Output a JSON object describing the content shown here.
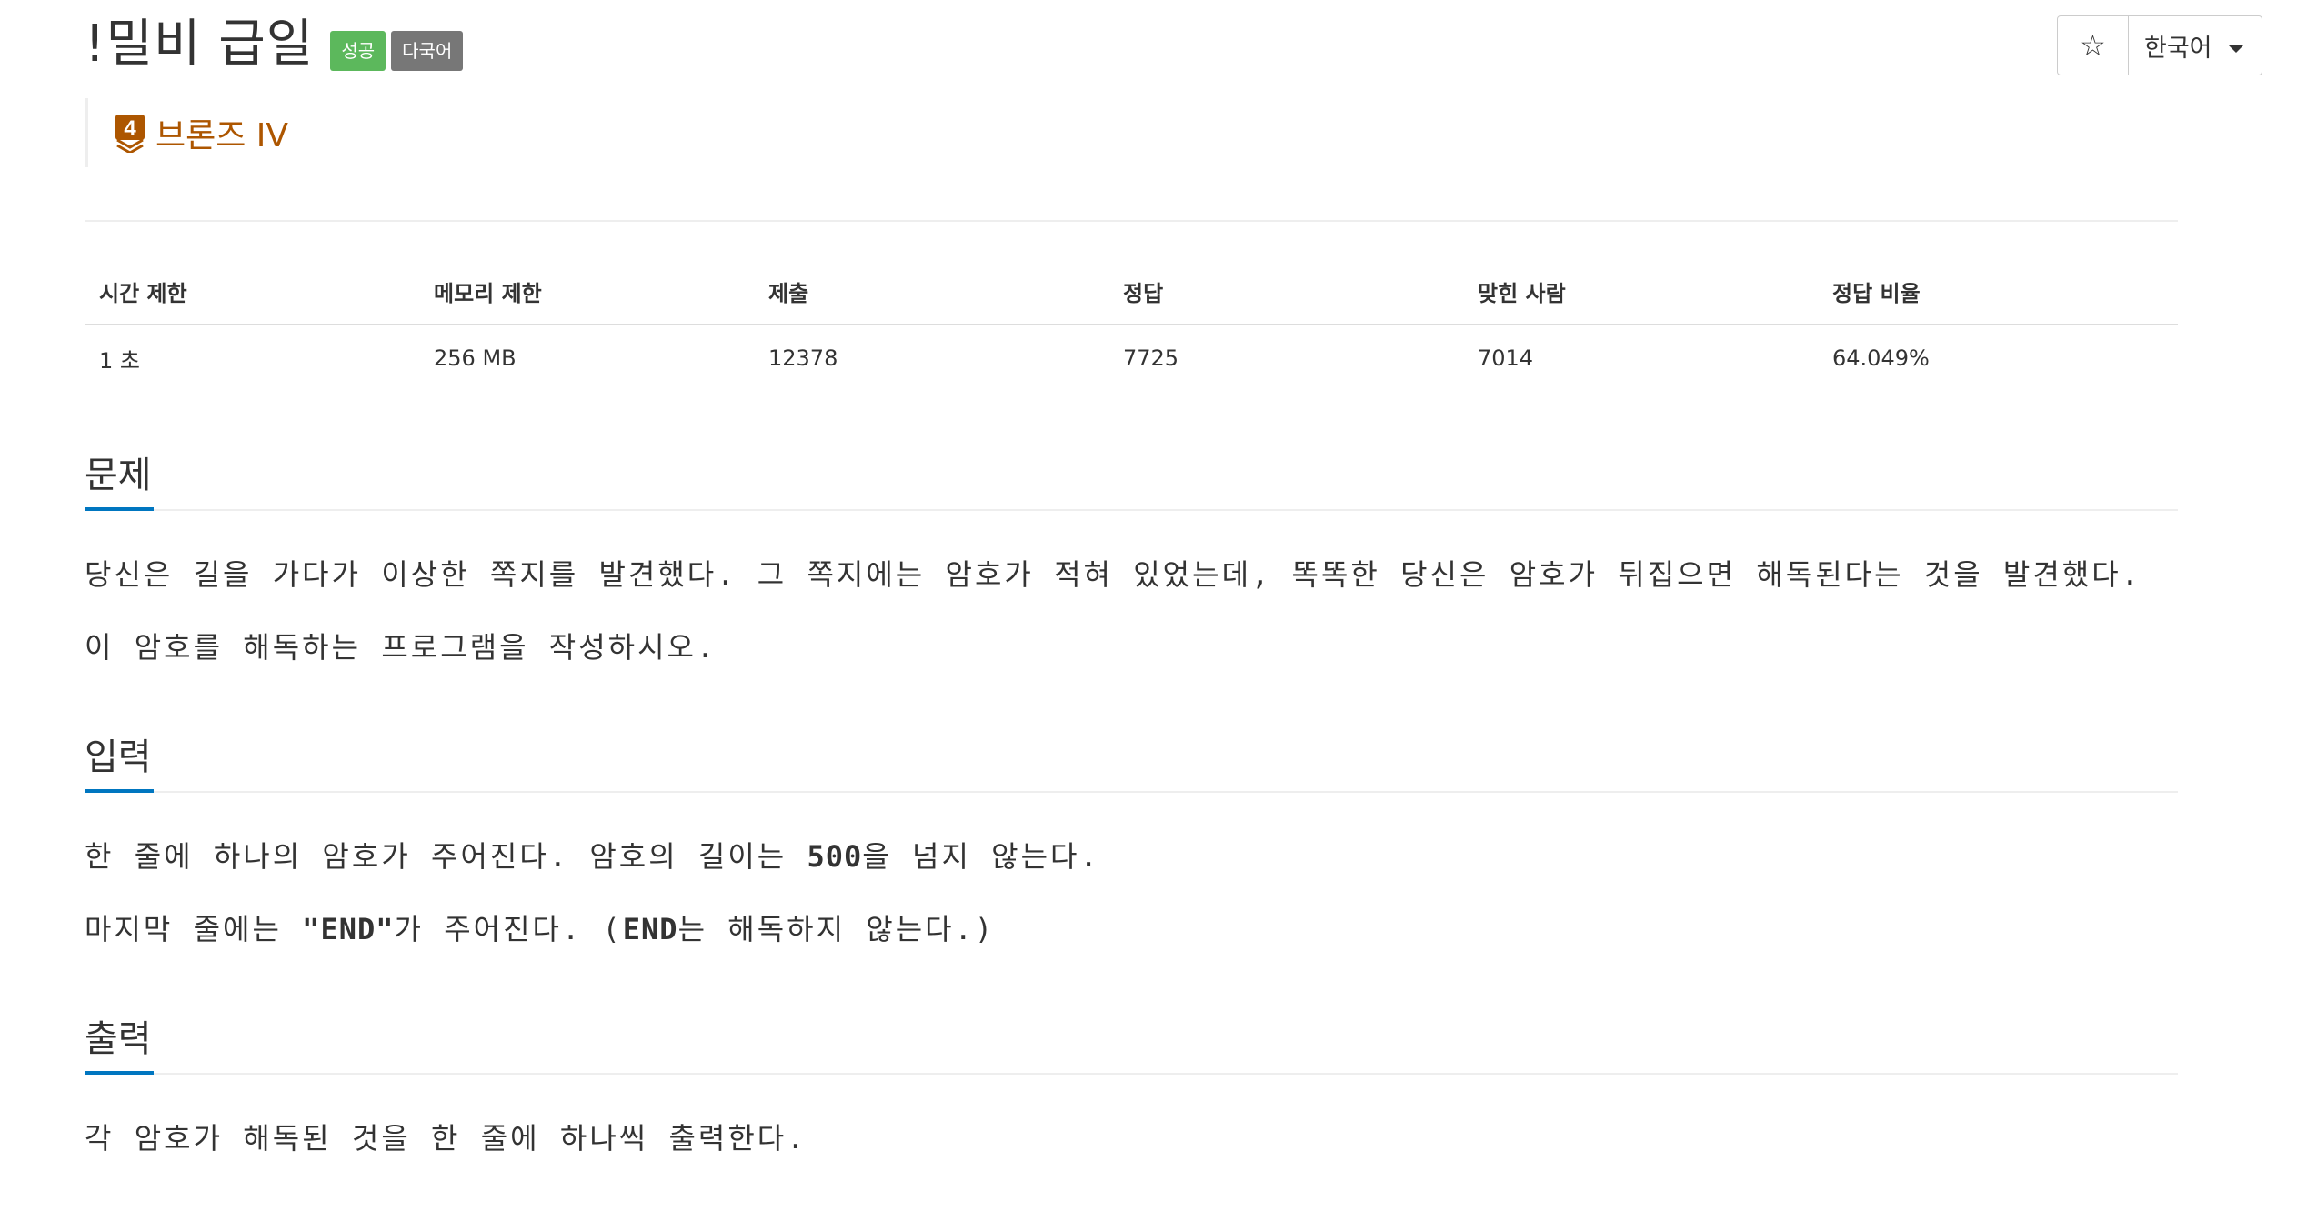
{
  "problem": {
    "title": "!밀비 급일",
    "labels": {
      "success": "성공",
      "multilang": "다국어"
    },
    "tier": "브론즈 IV",
    "tier_number": "4"
  },
  "toolbar": {
    "star_icon": "☆",
    "language": "한국어"
  },
  "info_table": {
    "headers": [
      "시간 제한",
      "메모리 제한",
      "제출",
      "정답",
      "맞힌 사람",
      "정답 비율"
    ],
    "values": [
      "1 초",
      "256 MB",
      "12378",
      "7725",
      "7014",
      "64.049%"
    ]
  },
  "sections": {
    "description": {
      "title": "문제",
      "lines": [
        "당신은 길을 가다가 이상한 쪽지를 발견했다. 그 쪽지에는 암호가 적혀 있었는데, 똑똑한 당신은 암호가 뒤집으면 해독된다는 것을 발견했다.",
        "이 암호를 해독하는 프로그램을 작성하시오."
      ]
    },
    "input": {
      "title": "입력",
      "line1_pre": "한 줄에 하나의 암호가 주어진다. 암호의 길이는 ",
      "line1_code": "500",
      "line1_post": "을 넘지 않는다.",
      "line2_pre": "마지막 줄에는 ",
      "line2_code": "\"END\"",
      "line2_mid": "가 주어진다. (",
      "line2_code2": "END",
      "line2_post": "는 해독하지 않는다.)"
    },
    "output": {
      "title": "출력",
      "lines": [
        "각 암호가 해독된 것을 한 줄에 하나씩 출력한다."
      ]
    }
  },
  "colors": {
    "success": "#5cb85c",
    "multilang": "#777777",
    "tier_bronze": "#ad5600",
    "section_accent": "#0076c0"
  }
}
